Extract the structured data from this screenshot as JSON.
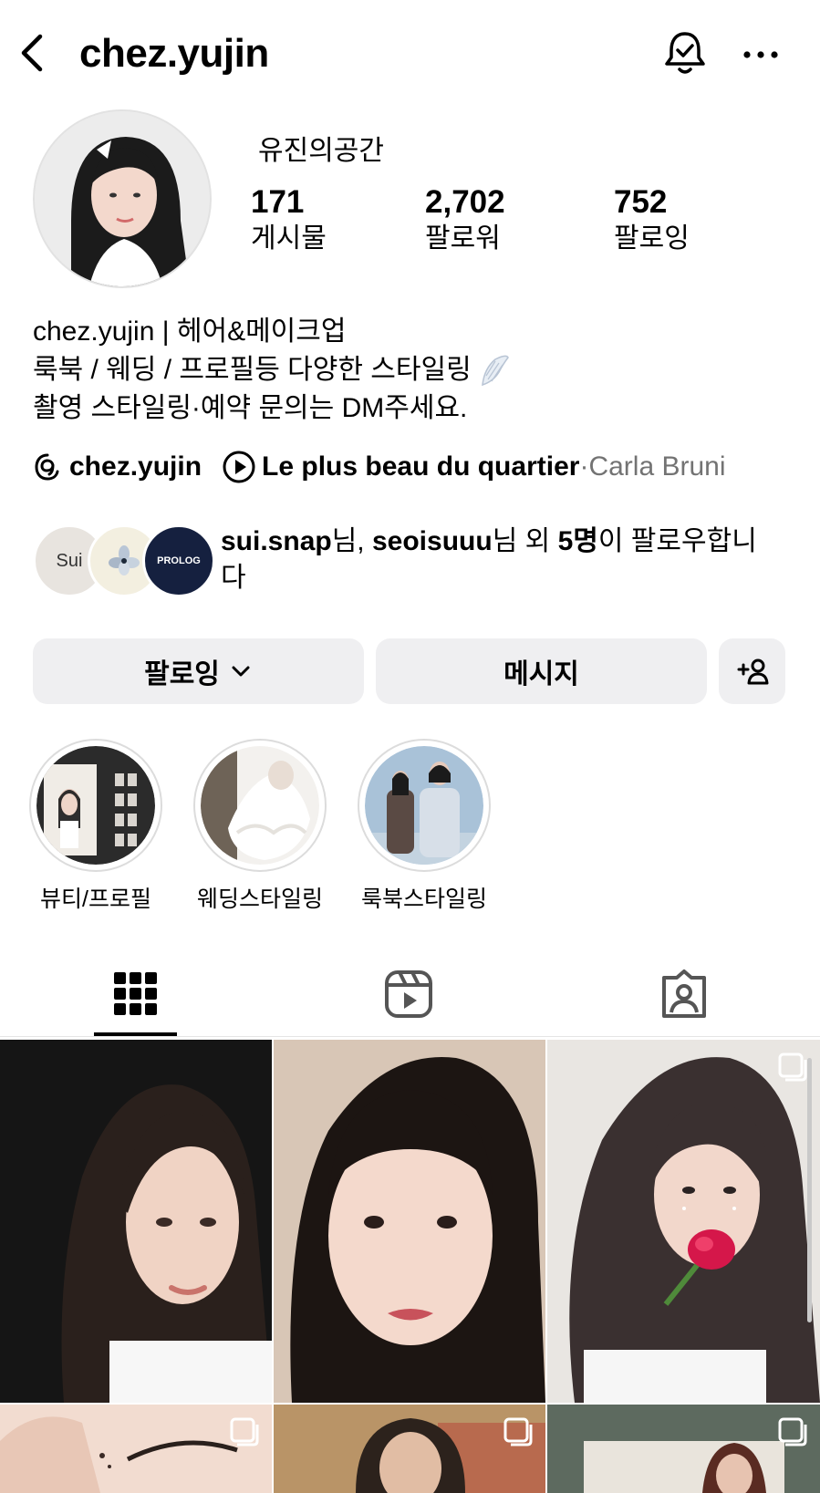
{
  "header": {
    "username": "chez.yujin"
  },
  "profile": {
    "display_name": "유진의공간",
    "stats": [
      {
        "value": "171",
        "label": "게시물"
      },
      {
        "value": "2,702",
        "label": "팔로워"
      },
      {
        "value": "752",
        "label": "팔로잉"
      }
    ],
    "bio": [
      "chez.yujin | 헤어&메이크업",
      "룩북 / 웨딩 / 프로필등 다양한 스타일링",
      "촬영 스타일링·예약 문의는 DM주세요."
    ],
    "threads_handle": "chez.yujin",
    "music_title": "Le plus beau du quartier",
    "music_separator": " · ",
    "music_artist": "Carla Bruni"
  },
  "followed_by": {
    "avatar_1_text": "Sui",
    "avatar_3_text": "PROLOG",
    "name_1": "sui.snap",
    "suffix_1": "님, ",
    "name_2": "seoisuuu",
    "suffix_2": "님 외 ",
    "count": "5명",
    "suffix_3": "이 팔로우합니다"
  },
  "actions": {
    "following_label": "팔로잉",
    "message_label": "메시지"
  },
  "highlights": [
    {
      "label": "뷰티/프로필"
    },
    {
      "label": "웨딩스타일링"
    },
    {
      "label": "룩북스타일링"
    }
  ],
  "colors": {
    "button_bg": "#efeff1",
    "secondary_text": "#737373",
    "prolog_bg": "#15203f"
  },
  "icons": [
    "back-arrow-icon",
    "bell-check-icon",
    "more-icon",
    "threads-icon",
    "play-icon",
    "chevron-down-icon",
    "add-person-icon",
    "grid-icon",
    "reels-icon",
    "tagged-icon",
    "multi-image-icon"
  ]
}
